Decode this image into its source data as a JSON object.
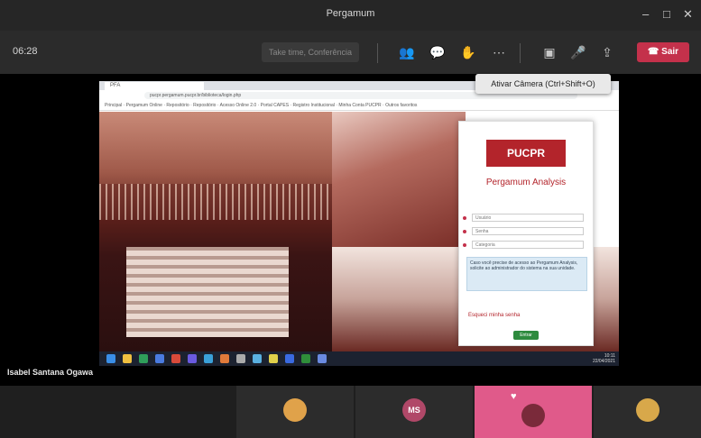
{
  "window": {
    "title": "Pergamum",
    "controls": [
      "minimize-icon",
      "maximize-icon",
      "close-icon"
    ]
  },
  "meeting": {
    "timer": "06:28",
    "toolbar_box_label": "Take time, Conferência",
    "toolbar_icons": [
      "participants-icon",
      "chat-icon",
      "reactions-icon",
      "more-icon",
      "camera-icon",
      "mic-icon",
      "share-icon"
    ],
    "leave_label": "Sair",
    "tooltip": "Ativar Câmera (Ctrl+Shift+O)",
    "presenter_name": "Isabel Santana Ogawa",
    "accent_color": "#c4314b"
  },
  "browser": {
    "tab_title": "PFA",
    "url": "pucpr.pergamum.pucpr.br/biblioteca/login.php",
    "bookmarks": [
      "Principal",
      "Pergamum Online",
      "Repositório",
      "Repositório",
      "Acesso Online 2.0",
      "Portal CAPES",
      "Registro Institucional",
      "Minha Conta PUCPR",
      "Outros favoritos"
    ]
  },
  "login": {
    "logo_text": "PUCPR",
    "app_name": "Pergamum Analysis",
    "fields": [
      "Usuário",
      "Senha",
      "Categoria"
    ],
    "info_text": "Caso você precise de acesso ao Pergamum Analysis, solicite ao administrador do sistema na sua unidade.",
    "link_text": "Esqueci minha senha",
    "enter_button": "Entrar",
    "brand_color": "#b3242b"
  },
  "taskbar": {
    "time": "10:11",
    "date": "22/04/2021"
  },
  "participants": [
    {
      "initials": "",
      "color": "#e0a24a",
      "type": "photo"
    },
    {
      "initials": "MS",
      "color": "#b04868",
      "type": "initials"
    },
    {
      "initials": "",
      "color": "#e05a8a",
      "type": "video"
    },
    {
      "initials": "",
      "color": "#d8a84a",
      "type": "photo"
    }
  ]
}
